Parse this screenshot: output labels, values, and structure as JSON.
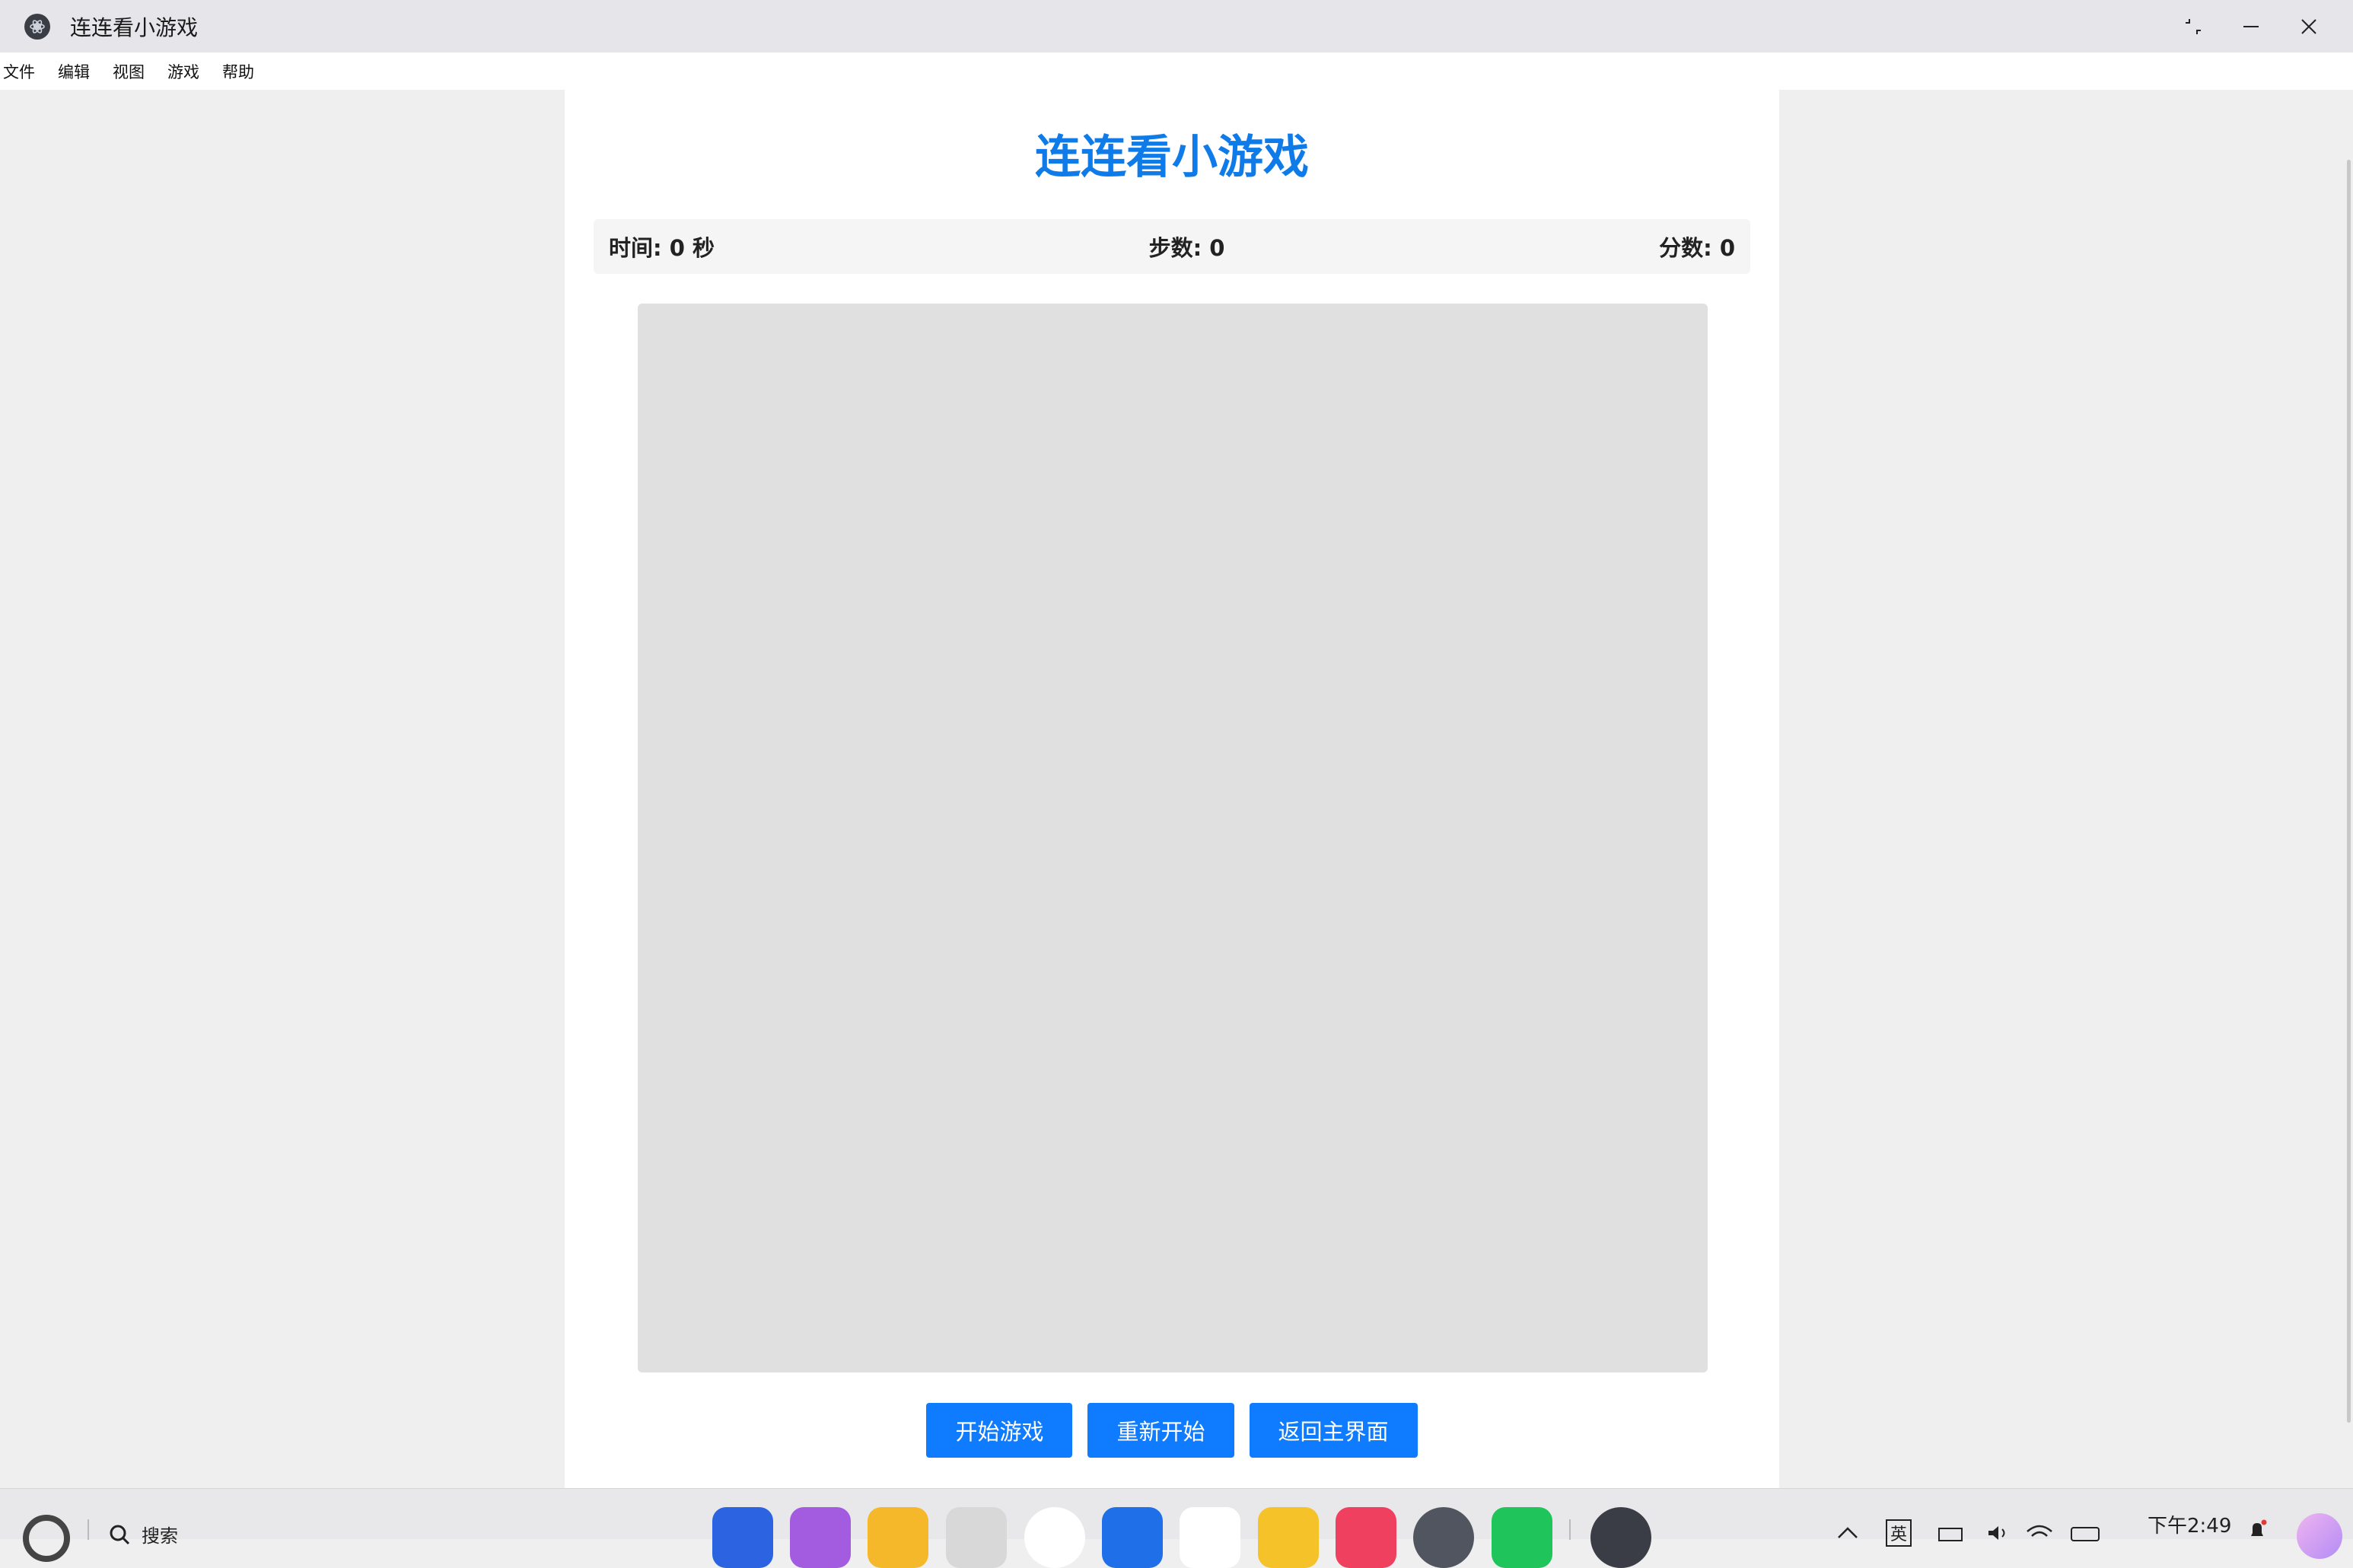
{
  "window": {
    "title": "连连看小游戏"
  },
  "menu": [
    "文件",
    "编辑",
    "视图",
    "游戏",
    "帮助"
  ],
  "game": {
    "title": "连连看小游戏",
    "time_label": "时间: 0 秒",
    "steps_label": "步数: 0",
    "score_label": "分数: 0"
  },
  "buttons": {
    "start": "开始游戏",
    "restart": "重新开始",
    "home": "返回主界面"
  },
  "taskbar": {
    "search_label": "搜索",
    "clock": "下午2:49",
    "ime": "英"
  },
  "colors": {
    "accent": "#0f7bff",
    "title_blue": "#0f7be8",
    "board": "#e0e0e0"
  }
}
